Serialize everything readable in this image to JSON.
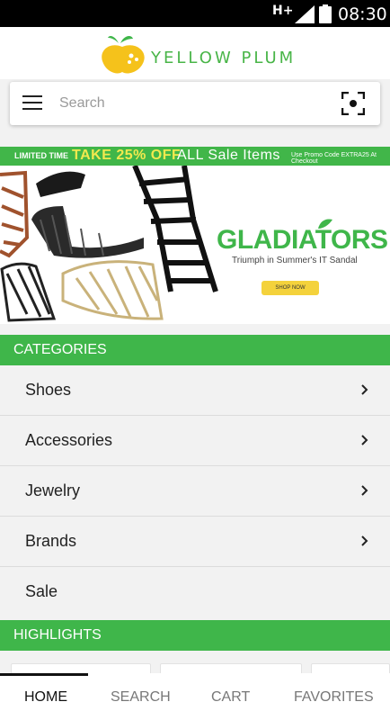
{
  "status_bar": {
    "network": "H+",
    "time": "08:30"
  },
  "header": {
    "brand": "YELLOW PLUM"
  },
  "search": {
    "placeholder": "Search"
  },
  "promo": {
    "limited": "LIMITED TIME",
    "take": "TAKE 25% OFF",
    "all_sale": "ALL Sale Items",
    "code_text": "Use Promo Code EXTRA25 At Checkout"
  },
  "banner": {
    "title": "GLADIATORS",
    "subtitle": "Triumph in Summer's IT Sandal",
    "button": "SHOP NOW"
  },
  "categories": {
    "heading": "CATEGORIES",
    "items": [
      {
        "label": "Shoes"
      },
      {
        "label": "Accessories"
      },
      {
        "label": "Jewelry"
      },
      {
        "label": "Brands"
      },
      {
        "label": "Sale"
      }
    ]
  },
  "highlights": {
    "heading": "HIGHLIGHTS"
  },
  "bottom_nav": {
    "items": [
      {
        "label": "HOME"
      },
      {
        "label": "SEARCH"
      },
      {
        "label": "CART"
      },
      {
        "label": "FAVORITES"
      }
    ],
    "active": "HOME"
  },
  "colors": {
    "brand_green": "#3fb64a",
    "logo_yellow": "#f5c21b",
    "promo_yellow": "#f2e94e"
  },
  "icons": [
    "signal-icon",
    "battery-icon",
    "menu-icon",
    "scan-icon",
    "chevron-right-icon",
    "plum-logo-icon"
  ]
}
